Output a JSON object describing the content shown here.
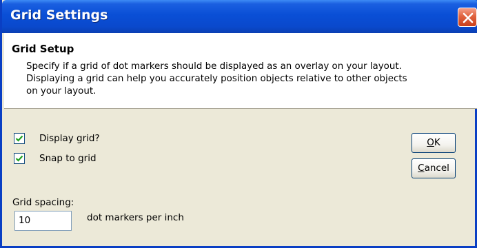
{
  "window": {
    "title": "Grid Settings",
    "close_icon": "close-icon"
  },
  "header": {
    "title": "Grid Setup",
    "description_line1": "Specify if a grid of dot markers should be displayed as an overlay on your layout.",
    "description_line2": "Displaying a grid can help you accurately position objects relative to other objects",
    "description_line3": "on your layout."
  },
  "options": {
    "display_grid": {
      "label": "Display grid?",
      "checked": true
    },
    "snap_to_grid": {
      "label": "Snap to grid",
      "checked": true
    }
  },
  "buttons": {
    "ok_accel": "O",
    "ok_rest": "K",
    "cancel_accel": "C",
    "cancel_rest": "ancel"
  },
  "spacing": {
    "label": "Grid spacing:",
    "value": "10",
    "unit": "dot markers per inch"
  },
  "colors": {
    "titlebar": "#0a4fd6",
    "dialog_bg": "#ece9d8",
    "check_mark": "#21a121",
    "close_button": "#e0623e"
  }
}
